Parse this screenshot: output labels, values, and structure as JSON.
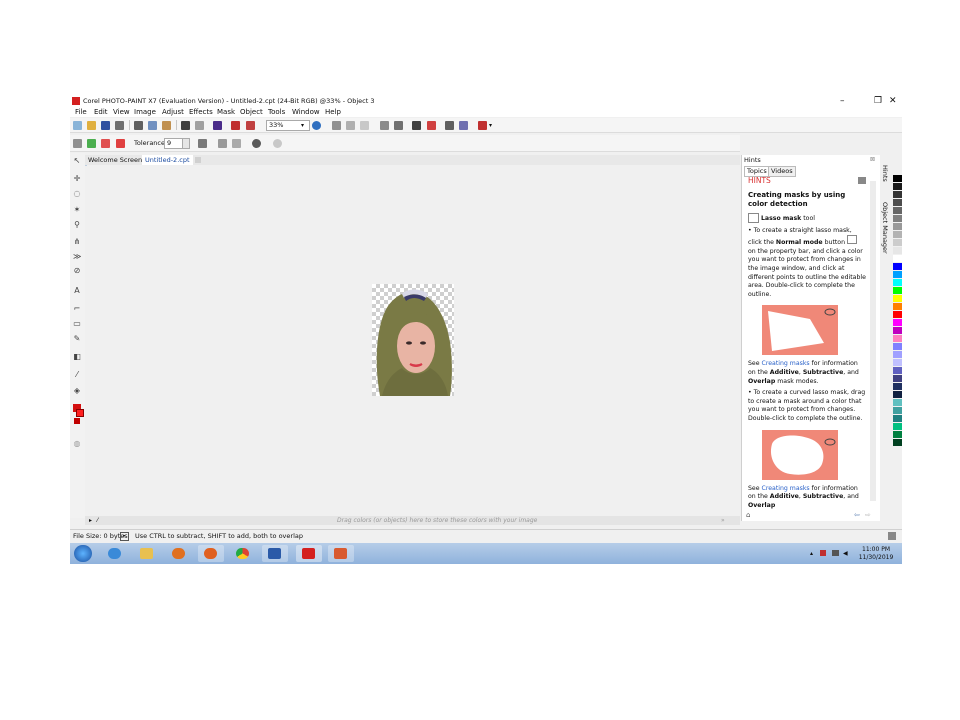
{
  "window": {
    "title": "Corel PHOTO-PAINT X7 (Evaluation Version) - Untitled-2.cpt (24-Bit RGB) @33% - Object 3",
    "minimize": "–",
    "restore": "❐",
    "close": "✕"
  },
  "menu": [
    "File",
    "Edit",
    "View",
    "Image",
    "Adjust",
    "Effects",
    "Mask",
    "Object",
    "Tools",
    "Window",
    "Help"
  ],
  "toolbar": {
    "zoom_value": "33%"
  },
  "property_bar": {
    "tolerance_label": "Tolerance:",
    "tolerance_value": "9"
  },
  "doc_tabs": [
    "Welcome Screen",
    "Untitled-2.cpt"
  ],
  "status_row": {
    "drag_hint": "Drag colors (or objects) here to store these colors with your image"
  },
  "hints_panel": {
    "header": "Hints",
    "tabs": [
      "Topics",
      "Videos"
    ],
    "section_title": "HINTS",
    "heading": "Creating masks by using color detection",
    "tool_name": "Lasso mask",
    "tool_suffix": " tool",
    "bullet1_a": "To create a straight lasso mask, click the ",
    "bullet1_bold": "Normal mode",
    "bullet1_b": " button",
    "bullet1_c": " on the property bar, and click a color you want to protect from changes in the image window, and click at different points to outline the editable area. Double-click to complete the outline.",
    "see_a": "See ",
    "see_link": "Creating masks",
    "see_b": " for information on the ",
    "see_additive": "Additive",
    "see_comma": ", ",
    "see_subtractive": "Subtractive",
    "see_and": ", and ",
    "see_overlap": "Overlap",
    "see_end": " mask modes.",
    "bullet2": "To create a curved lasso mask, drag to create a mask around a color that you want to protect from changes. Double-click to complete the outline.",
    "see2_a": "See ",
    "see2_link": "Creating masks",
    "see2_b": " for information on the ",
    "see2_additive": "Additive",
    "see2_comma": ", ",
    "see2_subtractive": "Subtractive",
    "see2_and": ", and ",
    "see2_overlap": "Overlap"
  },
  "side_tabs": [
    "Hints",
    "Object Manager"
  ],
  "status_bar": {
    "file_size": "File Size: 0 bytes",
    "hint": "Use CTRL to subtract, SHIFT to add, both to overlap"
  },
  "taskbar": {
    "time": "11:00 PM",
    "date": "11/30/2019"
  },
  "palette": [
    "#000000",
    "#1a1a1a",
    "#333333",
    "#4d4d4d",
    "#666666",
    "#808080",
    "#999999",
    "#b3b3b3",
    "#cccccc",
    "#e6e6e6",
    "#ffffff",
    "#0000ff",
    "#00a0ff",
    "#00ffff",
    "#00ff00",
    "#ffff00",
    "#ff8000",
    "#ff0000",
    "#ff00ff",
    "#c000c0",
    "#ff80c0",
    "#8080ff",
    "#a0a0ff",
    "#c0c0ff",
    "#6060c0",
    "#404080",
    "#203060",
    "#102040",
    "#60c0c0",
    "#40a0a0",
    "#208080",
    "#00c080",
    "#008040",
    "#004020"
  ]
}
